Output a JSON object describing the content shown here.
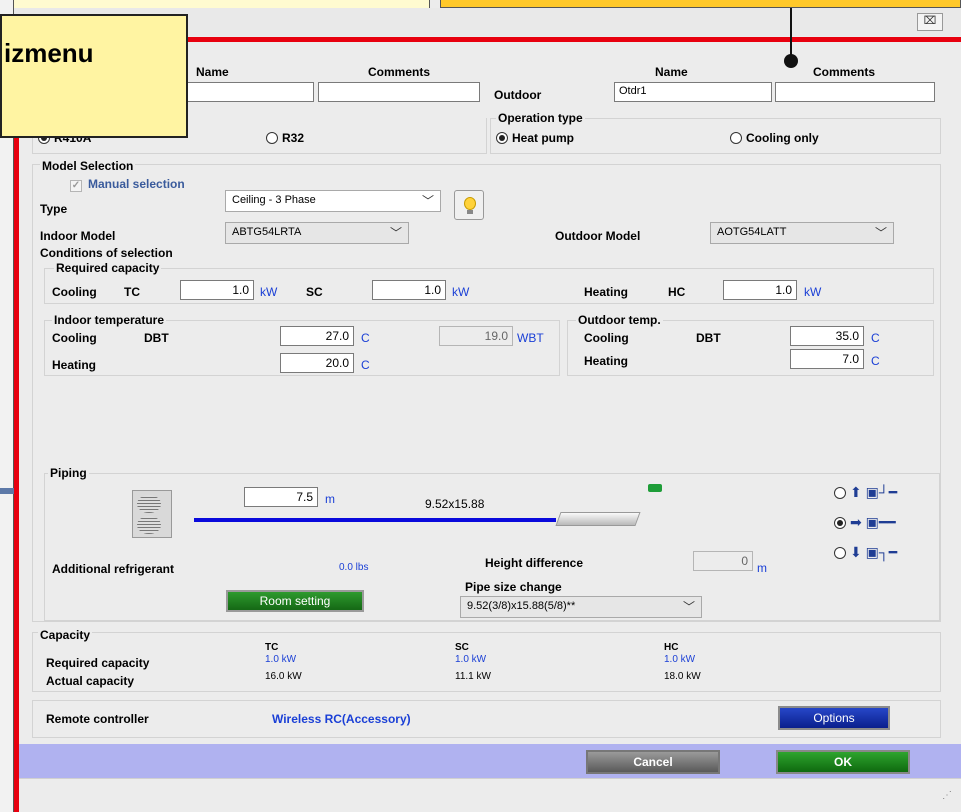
{
  "callout": {
    "text": "izmenu"
  },
  "window": {
    "close_icon": "close-icon"
  },
  "header": {
    "indoor_name_label": "Name",
    "indoor_comments_label": "Comments",
    "outdoor_label": "Outdoor",
    "outdoor_name_label": "Name",
    "outdoor_comments_label": "Comments",
    "outdoor_name_value": "Otdr1"
  },
  "refrigerant": {
    "option1": "R410A",
    "option2": "R32"
  },
  "operation": {
    "title": "Operation type",
    "option1": "Heat pump",
    "option2": "Cooling only"
  },
  "model": {
    "title": "Model Selection",
    "manual": "Manual selection",
    "type_label": "Type",
    "type_value": "Ceiling - 3 Phase",
    "indoor_label": "Indoor Model",
    "indoor_value": "ABTG54LRTA",
    "outdoor_label": "Outdoor Model",
    "outdoor_value": "AOTG54LATT"
  },
  "conditions": {
    "title": "Conditions of selection",
    "required_title": "Required capacity",
    "cooling": "Cooling",
    "tc": "TC",
    "tc_value": "1.0",
    "kw": "kW",
    "sc": "SC",
    "sc_value": "1.0",
    "heating": "Heating",
    "hc": "HC",
    "hc_value": "1.0"
  },
  "indoor_temp": {
    "title": "Indoor temperature",
    "cooling": "Cooling",
    "dbt": "DBT",
    "cooling_value": "27.0",
    "unit": "C",
    "wbt_value": "19.0",
    "wbt": "WBT",
    "heating": "Heating",
    "heating_value": "20.0"
  },
  "outdoor_temp": {
    "title": "Outdoor temp.",
    "cooling": "Cooling",
    "dbt": "DBT",
    "cooling_value": "35.0",
    "unit": "C",
    "heating": "Heating",
    "heating_value": "7.0"
  },
  "piping": {
    "title": "Piping",
    "length_value": "7.5",
    "length_unit": "m",
    "pipe_size": "9.52x15.88",
    "add_ref_label": "Additional refrigerant",
    "add_ref_value": "0.0 lbs",
    "height_label": "Height difference",
    "height_value": "0",
    "height_unit": "m",
    "size_change_label": "Pipe size change",
    "size_change_value": "9.52(3/8)x15.88(5/8)**",
    "room_setting": "Room setting"
  },
  "capacity": {
    "title": "Capacity",
    "tc": "TC",
    "sc": "SC",
    "hc": "HC",
    "required_label": "Required capacity",
    "actual_label": "Actual capacity",
    "req_tc": "1.0 kW",
    "req_sc": "1.0 kW",
    "req_hc": "1.0 kW",
    "act_tc": "16.0 kW",
    "act_sc": "11.1 kW",
    "act_hc": "18.0 kW"
  },
  "remote": {
    "label": "Remote controller",
    "value": "Wireless RC(Accessory)",
    "options": "Options"
  },
  "footer": {
    "cancel": "Cancel",
    "ok": "OK"
  }
}
